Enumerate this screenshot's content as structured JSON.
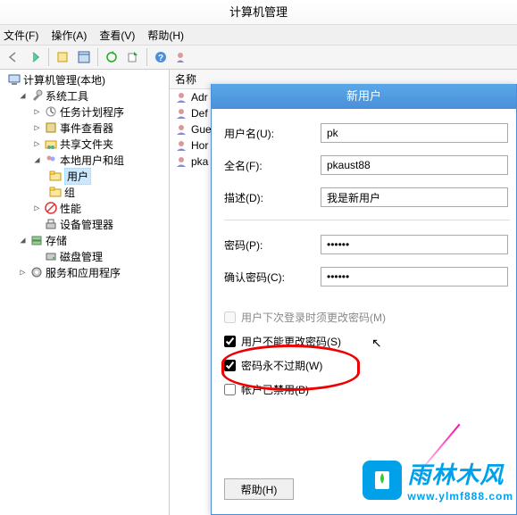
{
  "window_title": "计算机管理",
  "menu": {
    "file": "文件(F)",
    "action": "操作(A)",
    "view": "查看(V)",
    "help": "帮助(H)"
  },
  "tree": {
    "root": "计算机管理(本地)",
    "system_tools": "系统工具",
    "task_scheduler": "任务计划程序",
    "event_viewer": "事件查看器",
    "shared_folders": "共享文件夹",
    "local_users_groups": "本地用户和组",
    "users": "用户",
    "groups": "组",
    "performance": "性能",
    "device_manager": "设备管理器",
    "storage": "存储",
    "disk_management": "磁盘管理",
    "services_apps": "服务和应用程序"
  },
  "column_header": "名称",
  "list": [
    "Adr",
    "Def",
    "Gue",
    "Hor",
    "pka"
  ],
  "dialog": {
    "title": "新用户",
    "username_label": "用户名(U):",
    "username_value": "pk",
    "fullname_label": "全名(F):",
    "fullname_value": "pkaust88",
    "description_label": "描述(D):",
    "description_value": "我是新用户",
    "password_label": "密码(P):",
    "password_value": "••••••",
    "confirm_label": "确认密码(C):",
    "confirm_value": "••••••",
    "chk_change_next_login": "用户下次登录时须更改密码(M)",
    "chk_cannot_change": "用户不能更改密码(S)",
    "chk_never_expire": "密码永不过期(W)",
    "chk_disabled": "帐户已禁用(B)",
    "help_btn": "帮助(H)"
  },
  "watermark": {
    "cn": "雨林木风",
    "url": "www.ylmf888.com"
  }
}
